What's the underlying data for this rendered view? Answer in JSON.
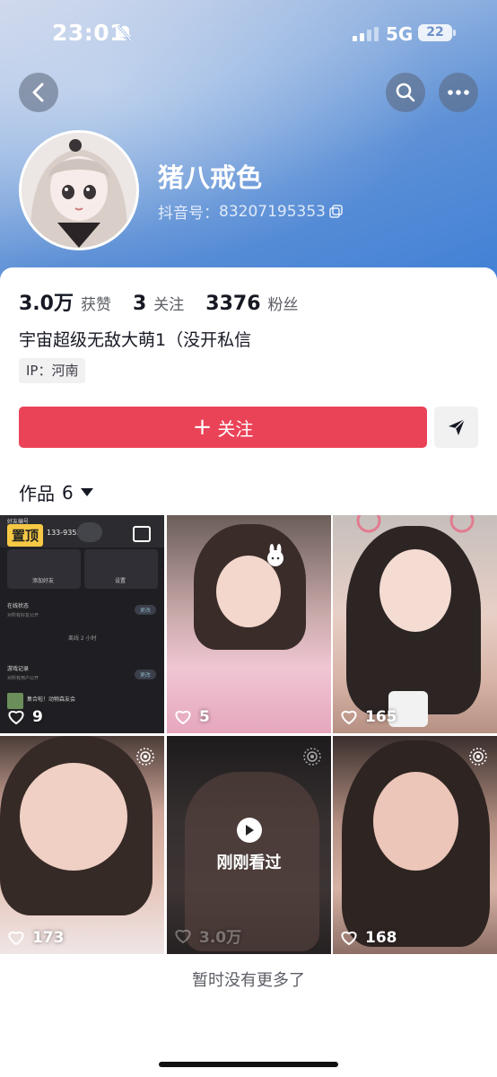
{
  "status_bar": {
    "time": "23:01",
    "network": "5G",
    "battery": "22"
  },
  "profile": {
    "nickname": "猪八戒色",
    "douyin_id_label": "抖音号：",
    "douyin_id": "83207195353",
    "stats": [
      {
        "value": "3.0万",
        "label": "获赞"
      },
      {
        "value": "3",
        "label": "关注"
      },
      {
        "value": "3376",
        "label": "粉丝"
      }
    ],
    "bio": "宇宙超级无敌大萌1（没开私信",
    "ip": "IP：河南"
  },
  "actions": {
    "follow_label": "关注",
    "follow_plus": "+"
  },
  "works": {
    "tab_label": "作品",
    "count": "6"
  },
  "videos": [
    {
      "likes": "9",
      "badge": "置顶"
    },
    {
      "likes": "5"
    },
    {
      "likes": "165"
    },
    {
      "likes": "173"
    },
    {
      "likes": "3.0万",
      "overlay": "刚刚看过"
    },
    {
      "likes": "168"
    }
  ],
  "tile1_screenshot": {
    "friend_code": "好友编号",
    "code_partial": "133-9352",
    "add_friend": "添加好友",
    "settings": "设置",
    "online_status": "在线状态",
    "online_desc": "对所有好友公开",
    "offline": "离线 2 小时",
    "game_record": "游戏记录",
    "game_desc": "对所有用户公开",
    "more": "更改",
    "event": "集合啦！动物森友会"
  },
  "footer": {
    "no_more": "暂时没有更多了"
  },
  "colors": {
    "accent": "#ea4358",
    "pinned": "#f6c844"
  }
}
